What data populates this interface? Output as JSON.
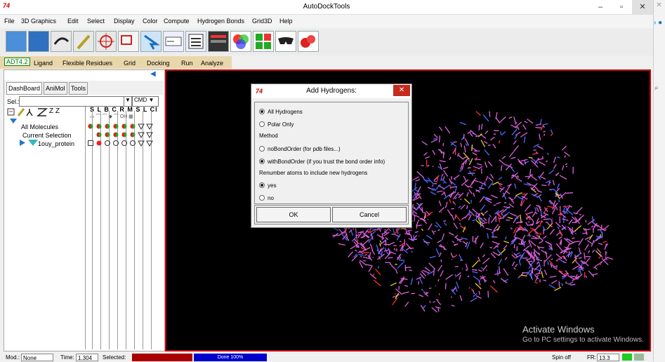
{
  "window": {
    "title": "AutoDockTools",
    "logo": "74",
    "minimize": "–",
    "maximize": "▫",
    "close": "✕"
  },
  "menu": [
    "File",
    "3D Graphics",
    "Edit",
    "Select",
    "Display",
    "Color",
    "Compute",
    "Hydrogen Bonds",
    "Grid3D",
    "Help"
  ],
  "toolbar_icons": [
    "open-icon",
    "save-icon",
    "undo-icon",
    "picker-icon",
    "center-icon",
    "select-icon",
    "arrow-icon",
    "command-icon",
    "dashboard-icon",
    "display-icon",
    "color-icon",
    "grid-icon",
    "stereo-icon",
    "molecule-icon"
  ],
  "tabs": [
    "ADT4.2",
    "Ligand",
    "Flexible Residues",
    "Grid",
    "Docking",
    "Run",
    "Analyze"
  ],
  "left_panel": {
    "tabs": [
      "DashBoard",
      "AniMol",
      "Tools"
    ],
    "sel_label": "Sel.:",
    "cmd": "CMD",
    "tree": {
      "root": "All Molecules",
      "current": "Current Selection",
      "molecule": "1ouy_protein"
    },
    "columns_header": "S L B C R M S L Cl",
    "z_icons": "Z Z"
  },
  "watermark": {
    "title": "Activate Windows",
    "subtitle": "Go to PC settings to activate Windows."
  },
  "status": {
    "mod_label": "Mod.:",
    "mod_value": "None",
    "time_label": "Time:",
    "time_value": "1.304",
    "selected_label": "Selected:",
    "progress_text": "Done 100%",
    "spin_label": "Spin off",
    "fr_label": "FR:",
    "fr_value": "13.3"
  },
  "dialog": {
    "title": "Add Hydrogens:",
    "options_hydrogens": [
      "All Hydrogens",
      "Polar Only"
    ],
    "method_label": "Method",
    "options_method": [
      "noBondOrder (for pdb files...)",
      "withBondOrder (if you trust the bond order info)"
    ],
    "renumber_label": "Renumber atoms to include new hydrogens",
    "options_renumber": [
      "yes",
      "no"
    ],
    "ok": "OK",
    "cancel": "Cancel"
  },
  "colors": {
    "viewer_border": "#c8000a",
    "tabbar": "#e9d7ac",
    "molecule": "#e060e0"
  }
}
